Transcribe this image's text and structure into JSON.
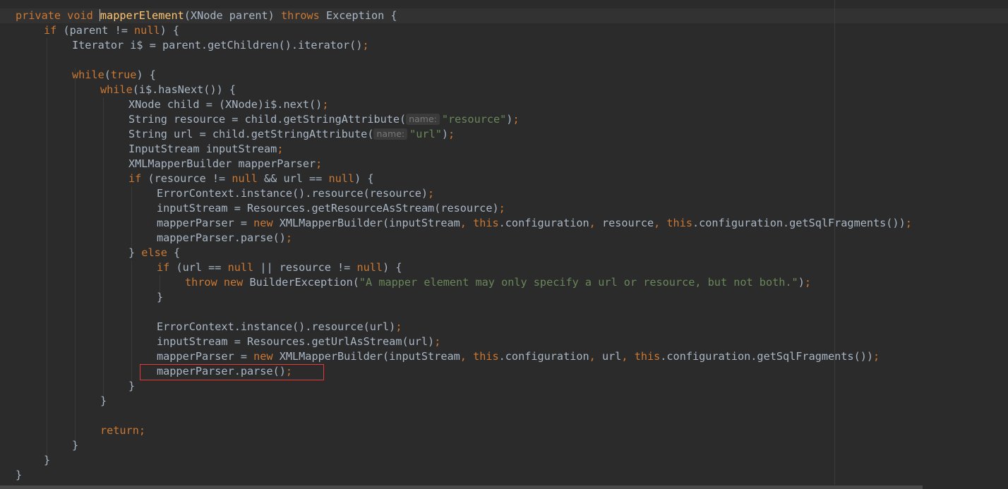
{
  "editor": {
    "colors": {
      "background": "#2b2b2b",
      "keyword": "#cc7832",
      "string": "#6a8759",
      "identifier": "#a9b7c6",
      "method_declaration": "#ffc66d",
      "highlight_box": "#e53935"
    },
    "lines": [
      {
        "indent": 0,
        "caret": true,
        "tokens": [
          {
            "t": "private",
            "c": "kw"
          },
          {
            "t": " "
          },
          {
            "t": "void",
            "c": "kw"
          },
          {
            "t": " "
          },
          {
            "t": "caret"
          },
          {
            "t": "mapperElement",
            "c": "fn"
          },
          {
            "t": "(XNode parent) "
          },
          {
            "t": "throws",
            "c": "kw"
          },
          {
            "t": " Exception {"
          }
        ]
      },
      {
        "indent": 1,
        "tokens": [
          {
            "t": "if",
            "c": "kw"
          },
          {
            "t": " (parent != "
          },
          {
            "t": "null",
            "c": "kw"
          },
          {
            "t": ") {"
          }
        ]
      },
      {
        "indent": 2,
        "tokens": [
          {
            "t": "Iterator i$ = parent.getChildren().iterator()"
          },
          {
            "t": ";",
            "c": "kw"
          }
        ]
      },
      {
        "indent": 0,
        "tokens": []
      },
      {
        "indent": 2,
        "tokens": [
          {
            "t": "while",
            "c": "kw"
          },
          {
            "t": "("
          },
          {
            "t": "true",
            "c": "kw"
          },
          {
            "t": ") {"
          }
        ]
      },
      {
        "indent": 3,
        "tokens": [
          {
            "t": "while",
            "c": "kw"
          },
          {
            "t": "(i$.hasNext()) {"
          }
        ]
      },
      {
        "indent": 4,
        "tokens": [
          {
            "t": "XNode child = (XNode)i$.next()"
          },
          {
            "t": ";",
            "c": "kw"
          }
        ]
      },
      {
        "indent": 4,
        "tokens": [
          {
            "t": "String resource = child.getStringAttribute("
          },
          {
            "t": "name:",
            "c": "hint"
          },
          {
            "t": "\"resource\"",
            "c": "str"
          },
          {
            "t": ")"
          },
          {
            "t": ";",
            "c": "kw"
          }
        ]
      },
      {
        "indent": 4,
        "tokens": [
          {
            "t": "String url = child.getStringAttribute("
          },
          {
            "t": "name:",
            "c": "hint"
          },
          {
            "t": "\"url\"",
            "c": "str"
          },
          {
            "t": ")"
          },
          {
            "t": ";",
            "c": "kw"
          }
        ]
      },
      {
        "indent": 4,
        "tokens": [
          {
            "t": "InputStream inputStream"
          },
          {
            "t": ";",
            "c": "kw"
          }
        ]
      },
      {
        "indent": 4,
        "tokens": [
          {
            "t": "XMLMapperBuilder mapperParser"
          },
          {
            "t": ";",
            "c": "kw"
          }
        ]
      },
      {
        "indent": 4,
        "tokens": [
          {
            "t": "if",
            "c": "kw"
          },
          {
            "t": " (resource != "
          },
          {
            "t": "null",
            "c": "kw"
          },
          {
            "t": " && url == "
          },
          {
            "t": "null",
            "c": "kw"
          },
          {
            "t": ") {"
          }
        ]
      },
      {
        "indent": 5,
        "tokens": [
          {
            "t": "ErrorContext.instance().resource(resource)"
          },
          {
            "t": ";",
            "c": "kw"
          }
        ]
      },
      {
        "indent": 5,
        "tokens": [
          {
            "t": "inputStream = Resources.getResourceAsStream(resource)"
          },
          {
            "t": ";",
            "c": "kw"
          }
        ]
      },
      {
        "indent": 5,
        "tokens": [
          {
            "t": "mapperParser = "
          },
          {
            "t": "new",
            "c": "kw"
          },
          {
            "t": " XMLMapperBuilder(inputStream"
          },
          {
            "t": ", ",
            "c": "kw"
          },
          {
            "t": "this",
            "c": "kw"
          },
          {
            "t": ".configuration"
          },
          {
            "t": ", ",
            "c": "kw"
          },
          {
            "t": "resource"
          },
          {
            "t": ", ",
            "c": "kw"
          },
          {
            "t": "this",
            "c": "kw"
          },
          {
            "t": ".configuration.getSqlFragments())"
          },
          {
            "t": ";",
            "c": "kw"
          }
        ]
      },
      {
        "indent": 5,
        "tokens": [
          {
            "t": "mapperParser.parse()"
          },
          {
            "t": ";",
            "c": "kw"
          }
        ]
      },
      {
        "indent": 4,
        "tokens": [
          {
            "t": "} "
          },
          {
            "t": "else",
            "c": "kw"
          },
          {
            "t": " {"
          }
        ]
      },
      {
        "indent": 5,
        "tokens": [
          {
            "t": "if",
            "c": "kw"
          },
          {
            "t": " (url == "
          },
          {
            "t": "null",
            "c": "kw"
          },
          {
            "t": " || resource != "
          },
          {
            "t": "null",
            "c": "kw"
          },
          {
            "t": ") {"
          }
        ]
      },
      {
        "indent": 6,
        "tokens": [
          {
            "t": "throw",
            "c": "kw"
          },
          {
            "t": " "
          },
          {
            "t": "new",
            "c": "kw"
          },
          {
            "t": " BuilderException("
          },
          {
            "t": "\"A mapper element may only specify a url or resource, but not both.\"",
            "c": "str"
          },
          {
            "t": ")"
          },
          {
            "t": ";",
            "c": "kw"
          }
        ]
      },
      {
        "indent": 5,
        "tokens": [
          {
            "t": "}"
          }
        ]
      },
      {
        "indent": 0,
        "tokens": []
      },
      {
        "indent": 5,
        "tokens": [
          {
            "t": "ErrorContext.instance().resource(url)"
          },
          {
            "t": ";",
            "c": "kw"
          }
        ]
      },
      {
        "indent": 5,
        "tokens": [
          {
            "t": "inputStream = Resources.getUrlAsStream(url)"
          },
          {
            "t": ";",
            "c": "kw"
          }
        ]
      },
      {
        "indent": 5,
        "tokens": [
          {
            "t": "mapperParser = "
          },
          {
            "t": "new",
            "c": "kw"
          },
          {
            "t": " XMLMapperBuilder(inputStream"
          },
          {
            "t": ", ",
            "c": "kw"
          },
          {
            "t": "this",
            "c": "kw"
          },
          {
            "t": ".configuration"
          },
          {
            "t": ", ",
            "c": "kw"
          },
          {
            "t": "url"
          },
          {
            "t": ", ",
            "c": "kw"
          },
          {
            "t": "this",
            "c": "kw"
          },
          {
            "t": ".configuration.getSqlFragments())"
          },
          {
            "t": ";",
            "c": "kw"
          }
        ]
      },
      {
        "indent": 5,
        "highlight": true,
        "tokens": [
          {
            "t": "mapperParser.parse()"
          },
          {
            "t": ";",
            "c": "kw"
          }
        ]
      },
      {
        "indent": 4,
        "tokens": [
          {
            "t": "}"
          }
        ]
      },
      {
        "indent": 3,
        "tokens": [
          {
            "t": "}"
          }
        ]
      },
      {
        "indent": 0,
        "tokens": []
      },
      {
        "indent": 3,
        "tokens": [
          {
            "t": "return",
            "c": "kw"
          },
          {
            "t": ";",
            "c": "kw"
          }
        ]
      },
      {
        "indent": 2,
        "tokens": [
          {
            "t": "}"
          }
        ]
      },
      {
        "indent": 1,
        "tokens": [
          {
            "t": "}"
          }
        ]
      },
      {
        "indent": 0,
        "tokens": [
          {
            "t": "}"
          }
        ]
      }
    ]
  }
}
